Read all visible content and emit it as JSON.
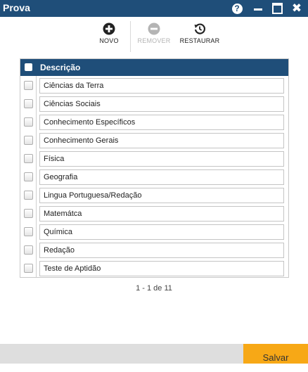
{
  "window": {
    "title": "Prova"
  },
  "titlebar_icons": [
    "help-icon",
    "minimize-icon",
    "maximize-icon",
    "close-icon"
  ],
  "titlebar": {
    "help_glyph": "?",
    "close_glyph": "✖"
  },
  "toolbar": {
    "novo": {
      "label": "NOVO",
      "icon": "plus-circle-icon",
      "enabled": true
    },
    "remover": {
      "label": "REMOVER",
      "icon": "minus-circle-icon",
      "enabled": false
    },
    "restaurar": {
      "label": "RESTAURAR",
      "icon": "restore-icon",
      "enabled": true
    }
  },
  "table": {
    "header": "Descrição",
    "rows": [
      "Ciências da Terra",
      "Ciências Sociais",
      "Conhecimento Específicos",
      "Conhecimento Gerais",
      "Física",
      "Geografia",
      "Lingua Portuguesa/Redação",
      "Matemátca",
      "Química",
      "Redação",
      "Teste de Aptidão"
    ]
  },
  "pager": {
    "text": "1 - 1 de 11"
  },
  "footer": {
    "save_label": "Salvar"
  },
  "colors": {
    "header": "#1f4e79",
    "save": "#f7a816",
    "footer_bg": "#dedede"
  }
}
